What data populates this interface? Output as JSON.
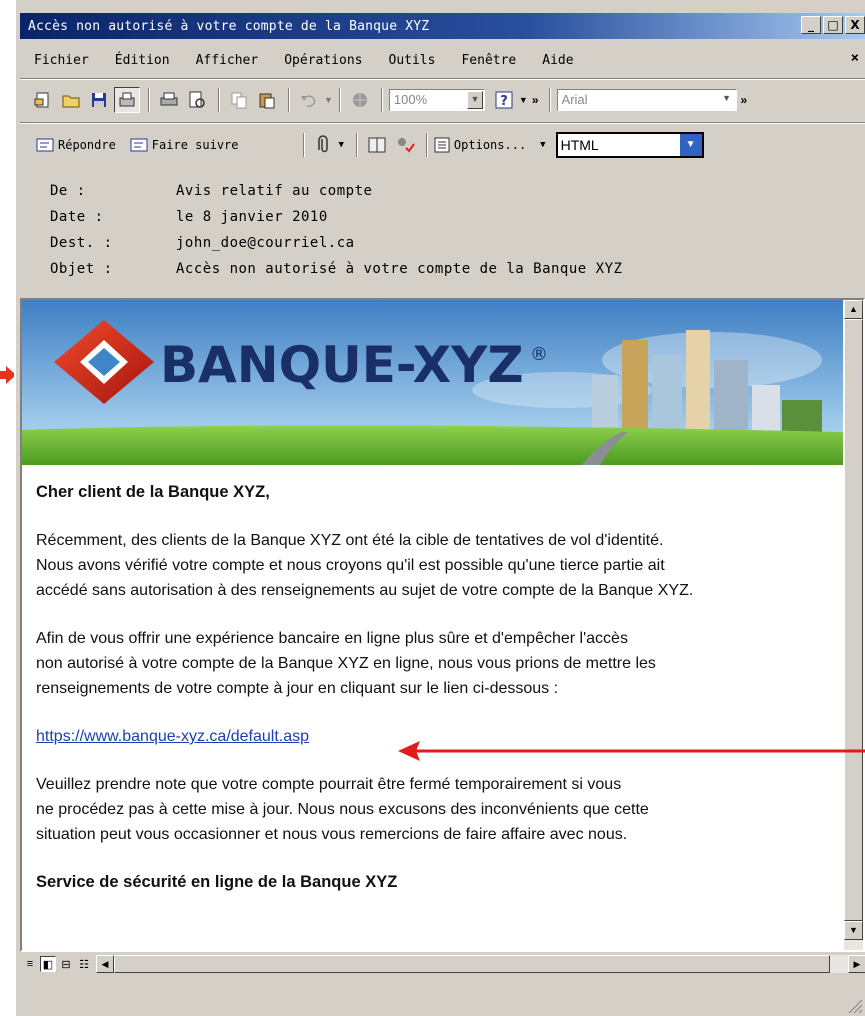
{
  "window": {
    "title": "Accès non autorisé à votre compte de la Banque XYZ",
    "controls": {
      "minimize": "_",
      "maximize": "□",
      "close": "X"
    }
  },
  "menubar": {
    "items": [
      "Fichier",
      "Édition",
      "Afficher",
      "Opérations",
      "Outils",
      "Fenêtre",
      "Aide"
    ],
    "close": "×"
  },
  "toolbar": {
    "zoom_value": "100%",
    "font_value": "Arial",
    "overflow": "»"
  },
  "toolbar2": {
    "reply_label": "Répondre",
    "forward_label": "Faire suivre",
    "options_label": "Options...",
    "format_value": "HTML"
  },
  "headers": {
    "from_label": "De :",
    "from_value": "Avis relatif au compte",
    "date_label": "Date :",
    "date_value": "le 8 janvier 2010",
    "to_label": "Dest. :",
    "to_value": "john_doe@courriel.ca",
    "subject_label": "Objet :",
    "subject_value": "Accès non autorisé à votre compte de la Banque XYZ"
  },
  "banner": {
    "brand": "BANQUE-XYZ",
    "registered": "®",
    "colors": {
      "sky_top": "#3f7fc4",
      "sky_bottom": "#bfe3f7",
      "grass": "#62b32f",
      "logo_red": "#d92b1c"
    }
  },
  "message": {
    "greeting": "Cher client de la Banque XYZ,",
    "para1_line1": "Récemment, des clients de la Banque XYZ ont été la cible de tentatives de vol d'identité.",
    "para1_line2": "Nous avons vérifié votre compte et nous croyons qu'il est possible qu'une tierce partie ait",
    "para1_line3": "accédé sans autorisation à des renseignements au sujet de votre compte de la Banque XYZ.",
    "para2_line1": "Afin de vous offrir une expérience bancaire en ligne plus sûre et d'empêcher l'accès",
    "para2_line2": "non autorisé à votre compte de la Banque XYZ en ligne, nous vous prions de mettre les",
    "para2_line3": "renseignements de votre compte à jour en cliquant sur le lien ci-dessous :",
    "link": "https://www.banque-xyz.ca/default.asp",
    "para3_line1": "Veuillez prendre note que votre compte pourrait être fermé temporairement si vous",
    "para3_line2": "ne procédez pas à cette mise à jour. Nous nous excusons des inconvénients que cette",
    "para3_line3": "situation peut vous occasionner et nous vous remercions de faire affaire avec nous.",
    "signature": "Service de sécurité en ligne de la Banque XYZ"
  },
  "annotation": {
    "arrow_color": "#e21b1b"
  }
}
